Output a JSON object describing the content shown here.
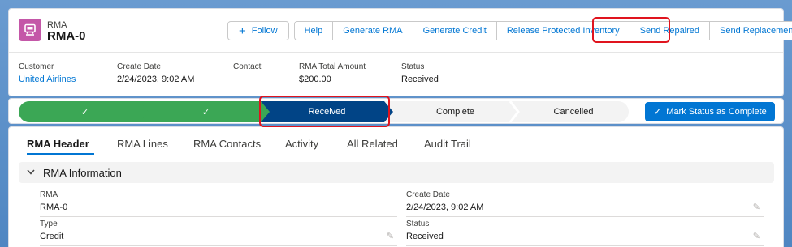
{
  "record": {
    "object_type": "RMA",
    "name": "RMA-0"
  },
  "actions": {
    "follow": "Follow",
    "buttons": [
      "Help",
      "Generate RMA",
      "Generate Credit",
      "Release Protected Inventory",
      "Send Repaired",
      "Send Replacement"
    ],
    "more_icon": "chevron-down-icon"
  },
  "highlights": [
    {
      "label": "Customer",
      "value": "United Airlines",
      "link": true
    },
    {
      "label": "Create Date",
      "value": "2/24/2023, 9:02 AM"
    },
    {
      "label": "Contact",
      "value": ""
    },
    {
      "label": "RMA Total Amount",
      "value": "$200.00"
    },
    {
      "label": "Status",
      "value": "Received"
    }
  ],
  "path": {
    "stages": [
      {
        "label": "",
        "state": "done"
      },
      {
        "label": "",
        "state": "done"
      },
      {
        "label": "Received",
        "state": "current"
      },
      {
        "label": "Complete",
        "state": "todo"
      },
      {
        "label": "Cancelled",
        "state": "todo"
      }
    ],
    "mark_button": "Mark Status as Complete"
  },
  "tabs": [
    "RMA Header",
    "RMA Lines",
    "RMA Contacts",
    "Activity",
    "All Related",
    "Audit Trail"
  ],
  "section": {
    "title": "RMA Information",
    "fields": [
      {
        "label": "RMA",
        "value": "RMA-0",
        "editable": false
      },
      {
        "label": "Create Date",
        "value": "2/24/2023, 9:02 AM",
        "editable": true
      },
      {
        "label": "Type",
        "value": "Credit",
        "editable": true
      },
      {
        "label": "Status",
        "value": "Received",
        "editable": true
      }
    ]
  },
  "colors": {
    "brand": "#0176d3",
    "path_done": "#3ba755",
    "path_current": "#014486",
    "highlight_box": "#e0141e",
    "object_icon": "#c457a8"
  }
}
